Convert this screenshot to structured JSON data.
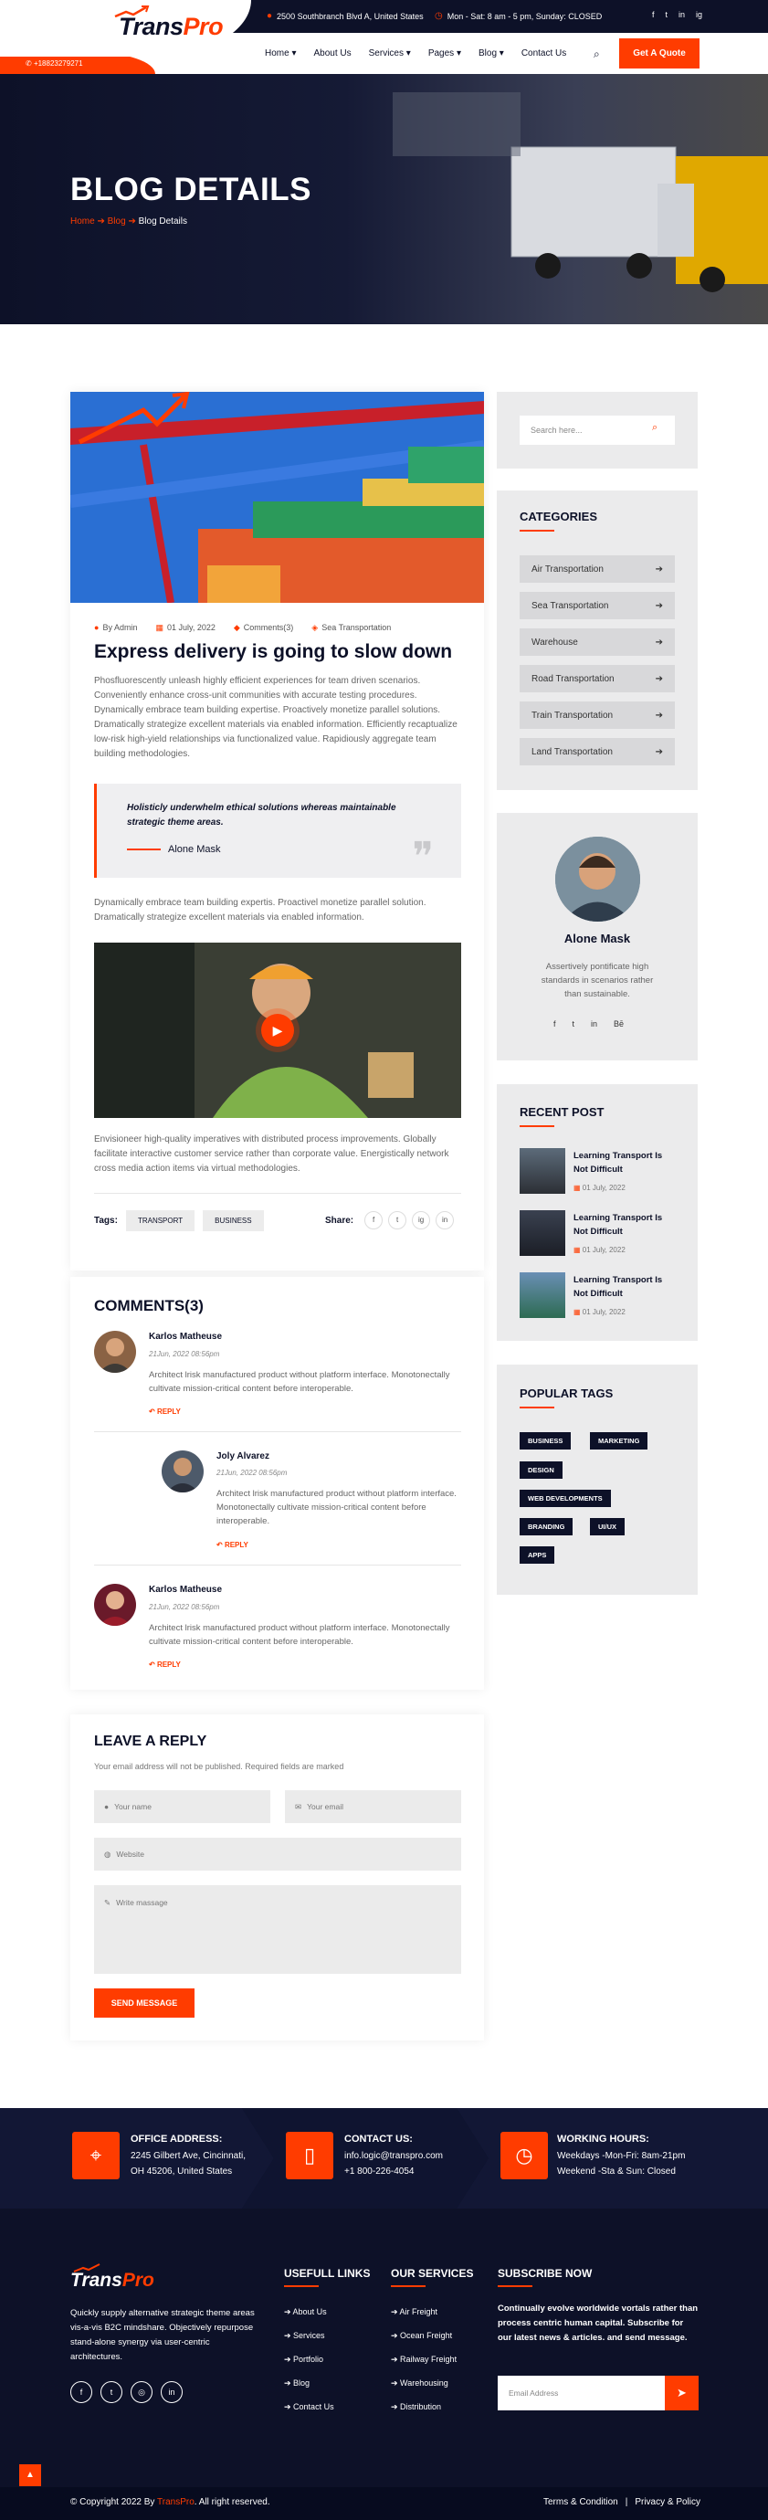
{
  "header": {
    "address": "2500 Southbranch Blvd A, United States",
    "hours": "Mon - Sat: 8 am - 5 pm, Sunday: CLOSED",
    "phone": "+18823279271",
    "logo_main": "Trans",
    "logo_accent": "Pro",
    "nav": [
      "Home",
      "About Us",
      "Services",
      "Pages",
      "Blog",
      "Contact Us"
    ],
    "nav_dropdown": [
      true,
      false,
      true,
      true,
      true,
      false
    ],
    "quote_button": "Get A Quote",
    "socials": [
      "f",
      "t",
      "in",
      "ig"
    ]
  },
  "hero": {
    "title": "BLOG DETAILS",
    "crumb_home": "Home",
    "crumb_blog": "Blog",
    "crumb_current": "Blog Details"
  },
  "post": {
    "author": "By Admin",
    "date": "01 July, 2022",
    "comments": "Comments(3)",
    "category": "Sea Transportation",
    "title": "Express delivery is going to slow down",
    "para1": "Phosfluorescently unleash highly efficient experiences for team driven scenarios. Conveniently enhance cross-unit communities with accurate testing procedures. Dynamically embrace team building expertise. Proactively monetize parallel solutions. Dramatically strategize excellent materials via enabled information. Efficiently recaptualize low-risk high-yield relationships via functionalized value. Rapidiously aggregate team building methodologies.",
    "quote": "Holisticly underwhelm ethical solutions whereas maintainable strategic theme areas.",
    "quote_author": "Alone Mask",
    "para2": "Dynamically embrace team building expertis. Proactivel monetize parallel solution. Dramatically strategize excellent materials via enabled information.",
    "para3": "Envisioneer high-quality imperatives with distributed process improvements. Globally facilitate interactive customer service rather than corporate value. Energistically network cross media action items via virtual methodologies.",
    "tags_label": "Tags:",
    "tags": [
      "TRANSPORT",
      "BUSINESS"
    ],
    "share_label": "Share:",
    "share_icons": [
      "f",
      "t",
      "ig",
      "in"
    ]
  },
  "comments": {
    "title": "COMMENTS(3)",
    "items": [
      {
        "name": "Karlos Matheuse",
        "date": "21Jun, 2022 08:56pm",
        "text": "Architect lrisk manufactured product without platform interface. Monotonectally cultivate mission-critical content before interoperable.",
        "reply": "REPLY"
      },
      {
        "name": "Joly Alvarez",
        "date": "21Jun, 2022 08:56pm",
        "text": "Architect lrisk manufactured product without platform interface. Monotonectally cultivate mission-critical content before interoperable.",
        "reply": "REPLY"
      },
      {
        "name": "Karlos Matheuse",
        "date": "21Jun, 2022 08:56pm",
        "text": "Architect lrisk manufactured product without platform interface. Monotonectally cultivate mission-critical content before interoperable.",
        "reply": "REPLY"
      }
    ]
  },
  "reply_form": {
    "title": "LEAVE A REPLY",
    "note": "Your email address will not be published. Required fields are marked",
    "name_ph": "Your name",
    "email_ph": "Your email",
    "website_ph": "Website",
    "message_ph": "Write massage",
    "button": "SEND MESSAGE"
  },
  "sidebar": {
    "search_ph": "Search here...",
    "categories_title": "CATEGORIES",
    "categories": [
      "Air Transportation",
      "Sea Transportation",
      "Warehouse",
      "Road Transportation",
      "Train Transportation",
      "Land Transportation"
    ],
    "profile_name": "Alone Mask",
    "profile_text": "Assertively pontificate high standards in scenarios rather than sustainable.",
    "profile_socials": [
      "f",
      "t",
      "in",
      "Bē"
    ],
    "recent_title": "RECENT POST",
    "recent": [
      {
        "title": "Learning Transport Is Not Difficult",
        "date": "01 July, 2022"
      },
      {
        "title": "Learning Transport Is Not Difficult",
        "date": "01 July, 2022"
      },
      {
        "title": "Learning Transport Is Not Difficult",
        "date": "01 July, 2022"
      }
    ],
    "tags_title": "POPULAR TAGS",
    "tags": [
      "BUSINESS",
      "MARKETING",
      "DESIGN",
      "WEB DEVELOPMENTS",
      "BRANDING",
      "UI/UX",
      "APPS"
    ]
  },
  "footer": {
    "office_title": "OFFICE ADDRESS:",
    "office_line1": "2245 Gilbert Ave, Cincinnati,",
    "office_line2": "OH 45206, United States",
    "contact_title": "CONTACT US:",
    "contact_line1": "info.logic@transpro.com",
    "contact_line2": "+1 800-226-4054",
    "hours_title": "WORKING HOURS:",
    "hours_line1": "Weekdays -Mon-Fri: 8am-21pm",
    "hours_line2": "Weekend -Sta & Sun: Closed",
    "about": "Quickly supply alternative strategic theme areas vis-a-vis B2C mindshare. Objectively repurpose stand-alone synergy via user-centric architectures.",
    "links_title": "USEFULL LINKS",
    "links": [
      "About Us",
      "Services",
      "Portfolio",
      "Blog",
      "Contact Us"
    ],
    "services_title": "OUR SERVICES",
    "services": [
      "Air Freight",
      "Ocean Freight",
      "Railway Freight",
      "Warehousing",
      "Distribution"
    ],
    "subscribe_title": "SUBSCRIBE NOW",
    "subscribe_text": "Continually evolve worldwide vortals rather than process centric human capital. Subscribe for our latest news & articles. and send message.",
    "email_ph": "Email Address",
    "socials": [
      "f",
      "t",
      "◎",
      "in"
    ],
    "copyright_pre": "© Copyright 2022 By ",
    "copyright_brand": "TransPro",
    "copyright_post": ". All right reserved.",
    "terms": "Terms & Condition",
    "privacy": "Privacy & Policy"
  },
  "colors": {
    "accent": "#ff3c00",
    "navy": "#0d1128",
    "panel": "#ebebec"
  }
}
